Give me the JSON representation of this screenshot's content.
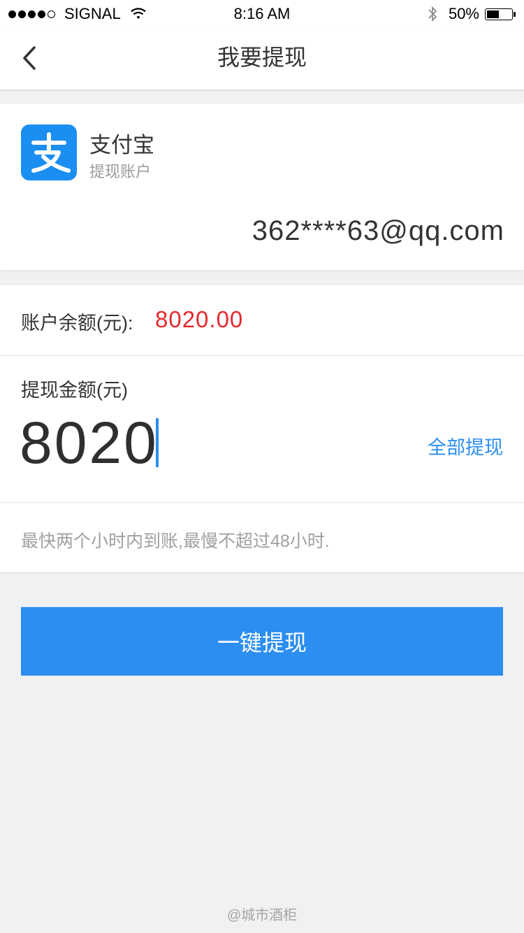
{
  "status_bar": {
    "carrier": "SIGNAL",
    "time": "8:16 AM",
    "battery_percent": "50%",
    "battery_level": 0.5,
    "signal_bars_filled": 4,
    "signal_bars_total": 5
  },
  "nav": {
    "title": "我要提现",
    "back_icon": "chevron-left-icon"
  },
  "account": {
    "logo_icon": "alipay-icon",
    "logo_color": "#1a8ef1",
    "name": "支付宝",
    "subtitle": "提现账户",
    "email": "362****63@qq.com"
  },
  "balance": {
    "label": "账户余额(元):",
    "value": "8020.00",
    "value_color": "#e5292c"
  },
  "amount": {
    "label": "提现金额(元)",
    "value": "8020",
    "withdraw_all": "全部提现"
  },
  "notice": "最快两个小时内到账,最慢不超过48小时.",
  "button": {
    "label": "一键提现",
    "color": "#2b8ef0"
  },
  "watermark": "@城市酒柜"
}
